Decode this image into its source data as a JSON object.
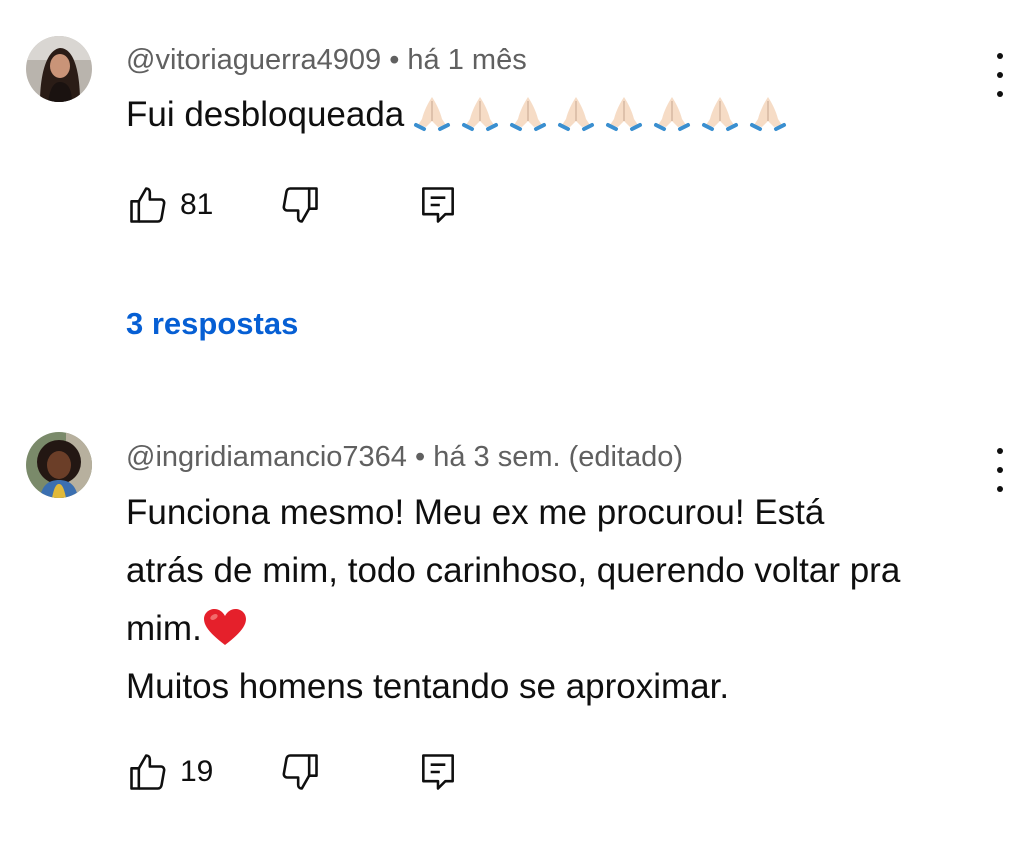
{
  "comments": [
    {
      "handle": "@vitoriaguerra4909",
      "separator": "•",
      "time": "há 1 mês",
      "edited": "",
      "lines": [
        "Fui desbloqueada"
      ],
      "emoji": "pray-emoji",
      "emoji_count": 8,
      "likes": "81",
      "replies_label": "3 respostas"
    },
    {
      "handle": "@ingridiamancio7364",
      "separator": "•",
      "time": "há 3 sem.",
      "edited": "(editado)",
      "lines": [
        "Funciona mesmo! Meu ex me procurou! Está",
        "atrás de mim, todo carinhoso, querendo voltar pra",
        "mim.",
        "Muitos homens tentando se aproximar."
      ],
      "emoji": "red-heart-emoji",
      "likes": "19"
    }
  ],
  "icons": {
    "like": "thumbs-up-icon",
    "dislike": "thumbs-down-icon",
    "reply": "reply-icon",
    "more": "more-vertical-icon"
  },
  "colors": {
    "link": "#065fd4",
    "meta": "#606060",
    "text": "#0f0f0f",
    "heart": "#e5202b"
  }
}
